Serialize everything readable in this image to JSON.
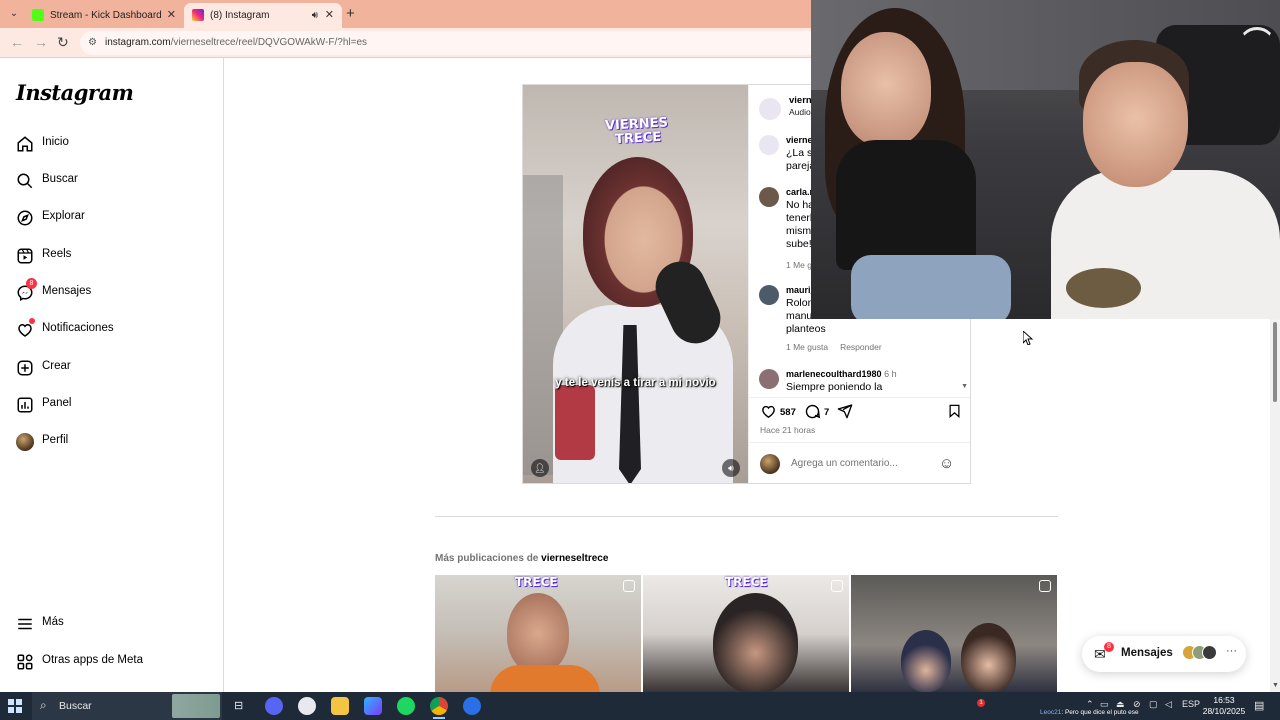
{
  "browser": {
    "tabs": [
      {
        "title": "Stream - Kick Dashboard",
        "active": false
      },
      {
        "title": "(8) Instagram",
        "active": true
      }
    ],
    "url_host": "instagram.com",
    "url_path": "/vierneseltrece/reel/DQVGOWAkW-F/?hl=es"
  },
  "sidebar": {
    "logo": "Instagram",
    "items": [
      {
        "label": "Inicio",
        "icon": "home-icon"
      },
      {
        "label": "Buscar",
        "icon": "search-icon"
      },
      {
        "label": "Explorar",
        "icon": "compass-icon"
      },
      {
        "label": "Reels",
        "icon": "reels-icon"
      },
      {
        "label": "Mensajes",
        "icon": "messenger-icon",
        "badge": "8"
      },
      {
        "label": "Notificaciones",
        "icon": "heart-icon",
        "dot": true
      },
      {
        "label": "Crear",
        "icon": "plus-square-icon"
      },
      {
        "label": "Panel",
        "icon": "chart-icon"
      },
      {
        "label": "Perfil",
        "icon": "profile-avatar"
      }
    ],
    "bottom": [
      {
        "label": "Más",
        "icon": "menu-icon"
      },
      {
        "label": "Otras apps de Meta",
        "icon": "meta-apps-icon"
      }
    ]
  },
  "post": {
    "video_subtitle": "y te le venís a tirar a mi novio",
    "video_logo_line1": "VIERNES",
    "video_logo_line2": "TRECE",
    "header_name": "vierne",
    "header_sub": "Audio",
    "comments": [
      {
        "user": "vierne",
        "text": "¿La su\npareja",
        "time": ""
      },
      {
        "user": "carla.r",
        "text": "No ha\ntenerl\nmism\nsube!",
        "meta": "1 Me gu"
      },
      {
        "user": "mauri_",
        "text": "Rolon\nmanu\nplanteos",
        "meta_likes": "1 Me gusta",
        "meta_reply": "Responder"
      },
      {
        "user": "marlenecoulthard1980",
        "time": "6 h",
        "text": "Siempre poniendo la"
      }
    ],
    "likes": "587",
    "comments_count": "7",
    "posted_ago": "Hace 21 horas",
    "add_comment_placeholder": "Agrega un comentario..."
  },
  "more": {
    "prefix": "Más publicaciones de",
    "account": "vierneseltrece",
    "thumb_logo": "TRECE"
  },
  "messages_pill": {
    "label": "Mensajes",
    "badge": "8"
  },
  "taskbar": {
    "search_label": "Buscar",
    "lang": "ESP",
    "time": "16:53",
    "date": "28/10/2025",
    "ticker_name": "Leoc21",
    "ticker_text": ": Pero que dice el puto ese",
    "tray_badge": "1"
  },
  "colors": {
    "tabbar": "#f1b39c",
    "addrbar": "#fde9e2",
    "notification_red": "#ff3040",
    "taskbar": "#1f2a38"
  }
}
